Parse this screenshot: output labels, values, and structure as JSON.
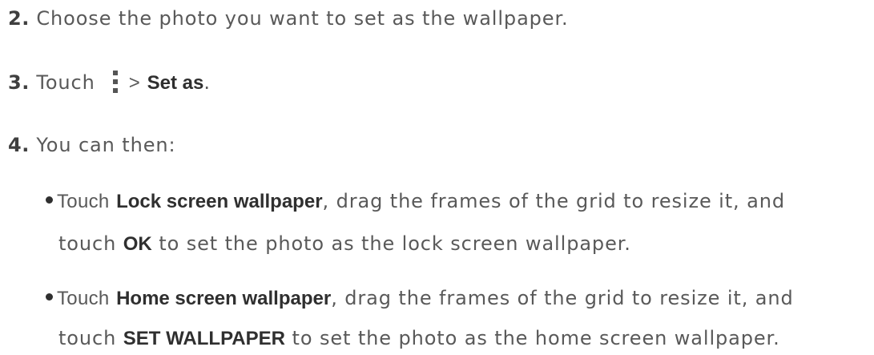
{
  "steps": {
    "step2": {
      "number": "2.",
      "text": "Choose the photo you want to set as the wallpaper."
    },
    "step3": {
      "number": "3.",
      "prefix": "Touch",
      "icon": "more-options-icon",
      "separator": ">",
      "bold": "Set as",
      "suffix": "."
    },
    "step4": {
      "number": "4.",
      "text": "You can then:"
    }
  },
  "options": [
    {
      "lead": "Touch",
      "bold": "Lock screen wallpaper",
      "rest1": ", drag the frames of the grid to resize it, and",
      "line2_lead": "touch",
      "bold2": "OK",
      "rest2": "to set the photo as the lock screen wallpaper."
    },
    {
      "lead": "Touch",
      "bold": "Home screen wallpaper",
      "rest1": ", drag the frames of the grid to resize it, and",
      "line2_lead": "touch",
      "bold2": "SET WALLPAPER",
      "rest2": "to set the photo as the home screen wallpaper."
    }
  ]
}
